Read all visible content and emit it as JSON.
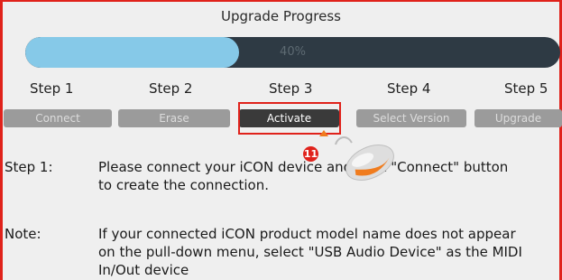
{
  "window": {
    "title": "Upgrade Progress"
  },
  "progress": {
    "value": 0.4,
    "label": "40%"
  },
  "steps": [
    {
      "label": "Step 1",
      "button": "Connect",
      "state": "disabled"
    },
    {
      "label": "Step 2",
      "button": "Erase",
      "state": "disabled"
    },
    {
      "label": "Step 3",
      "button": "Activate",
      "state": "active"
    },
    {
      "label": "Step 4",
      "button": "Select Version",
      "state": "disabled"
    },
    {
      "label": "Step 5",
      "button": "Upgrade",
      "state": "disabled"
    }
  ],
  "annotation": {
    "marker": "11"
  },
  "instructions": [
    {
      "label": "Step 1:",
      "text": "Please connect your iCON device and click \"Connect\" button to create the connection."
    },
    {
      "label": "Note:",
      "text": "If your connected iCON product model name does not appear on the pull-down menu, select \"USB Audio Device\" as the MIDI In/Out device"
    }
  ],
  "colors": {
    "progress_track": "#2e3a44",
    "progress_fill": "#86c9e8",
    "highlight": "#e0221b",
    "button_disabled": "#9b9b9b",
    "button_active": "#3a3a3a"
  },
  "icons": {
    "pointer": "mouse-icon"
  }
}
